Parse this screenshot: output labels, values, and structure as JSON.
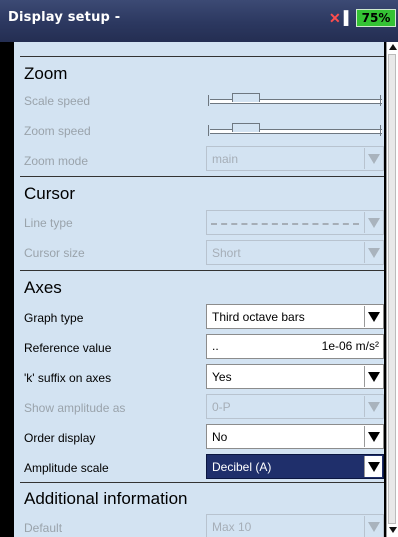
{
  "window": {
    "title": "Display setup -",
    "battery": "75%",
    "status_icons": [
      "no-signal-icon",
      "separator-icon"
    ]
  },
  "zoom": {
    "section_title": "Zoom",
    "scale_speed": {
      "label": "Scale speed",
      "level": 0.15
    },
    "zoom_speed": {
      "label": "Zoom speed",
      "level": 0.15
    },
    "zoom_mode": {
      "label": "Zoom mode",
      "value": "main"
    }
  },
  "cursor": {
    "section_title": "Cursor",
    "line_type": {
      "label": "Line type",
      "value": ""
    },
    "cursor_size": {
      "label": "Cursor size",
      "value": "Short"
    }
  },
  "axes": {
    "section_title": "Axes",
    "graph_type": {
      "label": "Graph type",
      "value": "Third octave bars"
    },
    "reference_value": {
      "label": "Reference value",
      "prefix": "..",
      "value": "1e-06 m/s²"
    },
    "k_suffix": {
      "label": "'k' suffix on axes",
      "value": "Yes"
    },
    "show_amplitude": {
      "label": "Show amplitude as",
      "value": "0-P"
    },
    "order_display": {
      "label": "Order display",
      "value": "No"
    },
    "amplitude_scale": {
      "label": "Amplitude scale",
      "value": "Decibel (A)"
    }
  },
  "additional": {
    "section_title": "Additional information",
    "default": {
      "label": "Default",
      "value": "Max 10"
    }
  },
  "colors": {
    "title_bar": "#2c3860",
    "panel": "#d3e3f2",
    "selection": "#1f2f6b",
    "battery": "#34c234",
    "alert": "#ff4d4d"
  }
}
